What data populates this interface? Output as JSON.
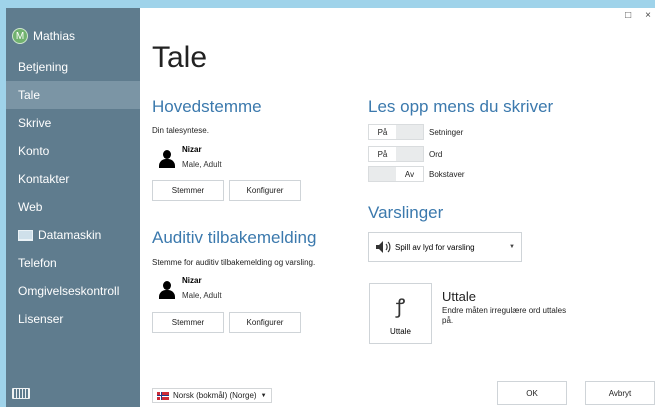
{
  "user": {
    "initial": "M",
    "name": "Mathias"
  },
  "nav": [
    {
      "label": "Betjening",
      "active": false
    },
    {
      "label": "Tale",
      "active": true
    },
    {
      "label": "Skrive",
      "active": false
    },
    {
      "label": "Konto",
      "active": false
    },
    {
      "label": "Kontakter",
      "active": false
    },
    {
      "label": "Web",
      "active": false
    },
    {
      "label": "Datamaskin",
      "active": false,
      "icon": "monitor-icon"
    },
    {
      "label": "Telefon",
      "active": false
    },
    {
      "label": "Omgivelseskontroll",
      "active": false
    },
    {
      "label": "Lisenser",
      "active": false
    }
  ],
  "window": {
    "minimize": "□",
    "close": "×"
  },
  "page_title": "Tale",
  "main_voice": {
    "heading": "Hovedstemme",
    "description": "Din talesyntese.",
    "voice_name": "Nizar",
    "voice_desc": "Male, Adult",
    "voices_button": "Stemmer",
    "configure_button": "Konfigurer"
  },
  "feedback": {
    "heading": "Auditiv tilbakemelding",
    "description": "Stemme for auditiv tilbakemelding og varsling.",
    "voice_name": "Nizar",
    "voice_desc": "Male, Adult",
    "voices_button": "Stemmer",
    "configure_button": "Konfigurer"
  },
  "read_aloud": {
    "heading": "Les opp mens du skriver",
    "toggles": [
      {
        "state": "På",
        "label": "Setninger",
        "on": true
      },
      {
        "state": "På",
        "label": "Ord",
        "on": true
      },
      {
        "state": "Av",
        "label": "Bokstaver",
        "on": false
      }
    ]
  },
  "notifications": {
    "heading": "Varslinger",
    "dropdown_value": "Spill av lyd for varsling"
  },
  "pronunciation": {
    "button_label": "Uttale",
    "title": "Uttale",
    "description": "Endre måten irregulære ord uttales på."
  },
  "language": "Norsk (bokmål) (Norge)",
  "ok_button": "OK",
  "cancel_button": "Avbryt"
}
